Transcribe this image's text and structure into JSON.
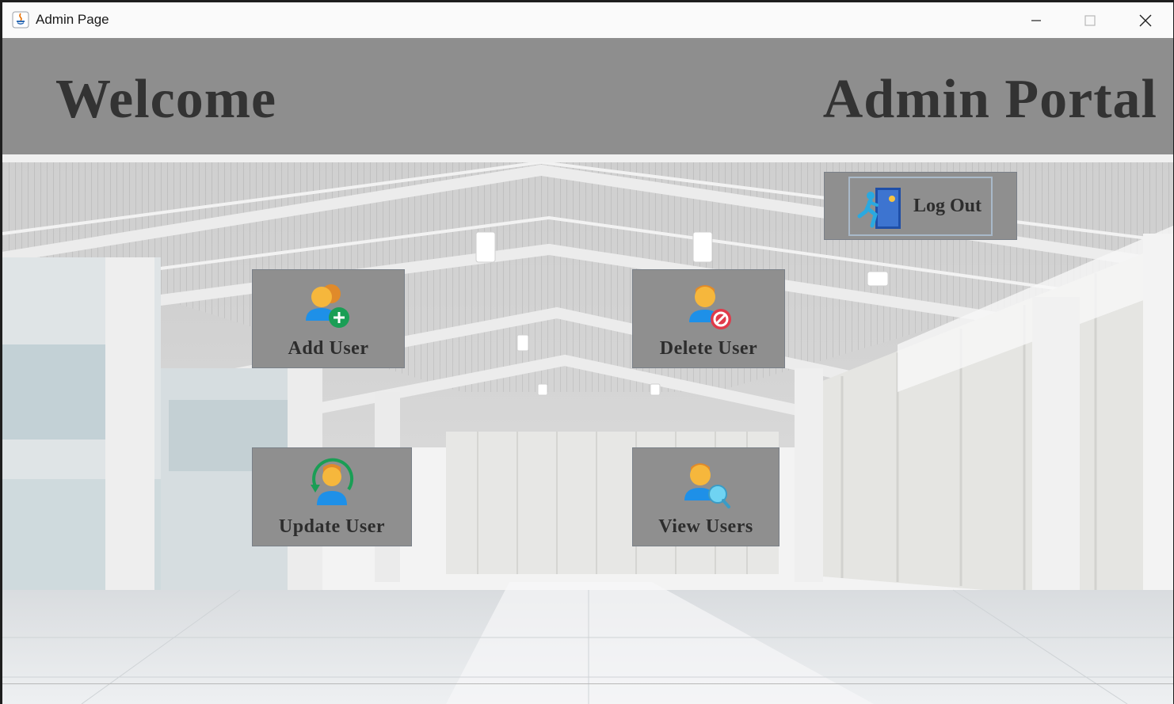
{
  "window": {
    "title": "Admin Page",
    "controls": [
      "minimize-icon",
      "maximize-icon",
      "close-icon"
    ]
  },
  "header": {
    "welcome": "Welcome",
    "portal": "Admin Portal",
    "background": "#8e8e8e",
    "text_color": "#333333"
  },
  "actions": {
    "logout": {
      "label": "Log Out",
      "icon": "exit-door-icon"
    },
    "add_user": {
      "label": "Add User",
      "icon": "add-user-icon"
    },
    "delete_user": {
      "label": "Delete User",
      "icon": "delete-user-icon"
    },
    "update_user": {
      "label": "Update User",
      "icon": "update-user-icon"
    },
    "view_users": {
      "label": "View Users",
      "icon": "search-user-icon"
    }
  },
  "colors": {
    "tile": "#8f8f8f",
    "tile_text": "#2d2d2d",
    "user_skin": "#f6b73c",
    "user_shirt": "#1e90e8",
    "add_badge": "#1a9e55",
    "delete_badge": "#e03a4a",
    "view_lens": "#6fd3f2",
    "exit_door": "#1f4fa8"
  }
}
